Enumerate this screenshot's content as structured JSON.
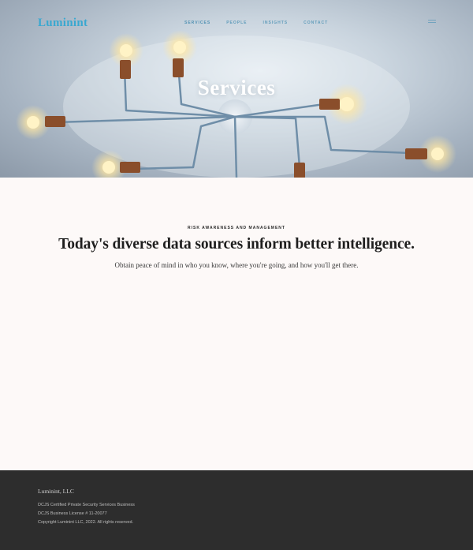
{
  "header": {
    "logo": "Luminint",
    "nav": [
      {
        "label": "Services"
      },
      {
        "label": "People"
      },
      {
        "label": "Insights"
      },
      {
        "label": "Contact"
      }
    ]
  },
  "hero": {
    "title": "Services"
  },
  "main": {
    "eyebrow": "Risk Awareness and Management",
    "headline": "Today's diverse data sources inform better intelligence.",
    "subline": "Obtain peace of mind in who you know, where you're going, and how you'll get there."
  },
  "footer": {
    "brand": "Luminint, LLC",
    "lines": [
      "DCJS Certified Private Security Services Business",
      "DCJS Business License # 11-20077",
      "Copyright Luminint LLC, 2022.  All rights reserved."
    ]
  },
  "colors": {
    "accent": "#39a8d0",
    "footer_bg": "#2d2d2d",
    "page_bg": "#fdf9f8"
  },
  "icons": [
    "menu-icon"
  ]
}
